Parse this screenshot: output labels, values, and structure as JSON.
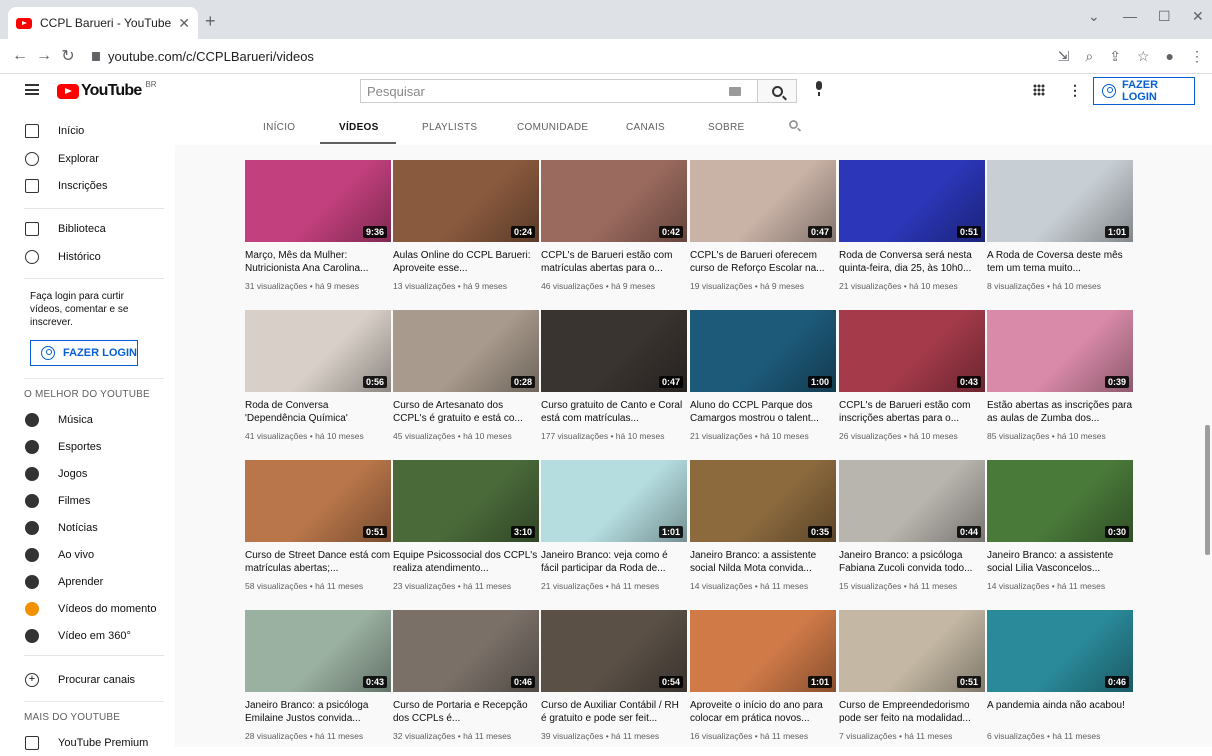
{
  "browser": {
    "tab_title": "CCPL Barueri - YouTube",
    "url": "youtube.com/c/CCPLBarueri/videos"
  },
  "header": {
    "logo_text": "YouTube",
    "country_code": "BR",
    "search_placeholder": "Pesquisar",
    "login_label": "FAZER LOGIN"
  },
  "sidebar": {
    "items": [
      {
        "label": "Início",
        "icon": "home-icon"
      },
      {
        "label": "Explorar",
        "icon": "compass-icon"
      },
      {
        "label": "Inscrições",
        "icon": "subscriptions-icon"
      },
      {
        "label": "Biblioteca",
        "icon": "library-icon"
      },
      {
        "label": "Histórico",
        "icon": "history-icon"
      }
    ],
    "login_message": "Faça login para curtir vídeos, comentar e se inscrever.",
    "login_label": "FAZER LOGIN",
    "best_heading": "O MELHOR DO YOUTUBE",
    "best_items": [
      {
        "label": "Música",
        "icon": "music-icon"
      },
      {
        "label": "Esportes",
        "icon": "trophy-icon"
      },
      {
        "label": "Jogos",
        "icon": "gamepad-icon"
      },
      {
        "label": "Filmes",
        "icon": "film-icon"
      },
      {
        "label": "Notícias",
        "icon": "news-icon"
      },
      {
        "label": "Ao vivo",
        "icon": "live-icon"
      },
      {
        "label": "Aprender",
        "icon": "bulb-icon"
      },
      {
        "label": "Vídeos do momento",
        "icon": "trending-icon"
      },
      {
        "label": "Vídeo em 360°",
        "icon": "360-icon"
      }
    ],
    "browse_channels": "Procurar canais",
    "more_heading": "MAIS DO YOUTUBE",
    "more_items": [
      {
        "label": "YouTube Premium",
        "icon": "youtube-premium-icon"
      }
    ]
  },
  "channel_tabs": [
    "INÍCIO",
    "VÍDEOS",
    "PLAYLISTS",
    "COMUNIDADE",
    "CANAIS",
    "SOBRE"
  ],
  "videos": [
    {
      "title": "Março, Mês da Mulher: Nutricionista Ana Carolina...",
      "meta": "31 visualizações • há 9 meses",
      "duration": "9:36",
      "color": "#c2407d"
    },
    {
      "title": "Aulas Online do CCPL Barueri: Aproveite esse...",
      "meta": "13 visualizações • há 9 meses",
      "duration": "0:24",
      "color": "#8a5a3e"
    },
    {
      "title": "CCPL's de Barueri estão com matrículas abertas para o...",
      "meta": "46 visualizações • há 9 meses",
      "duration": "0:42",
      "color": "#9b6a5e"
    },
    {
      "title": "CCPL's de Barueri oferecem curso de Reforço Escolar na...",
      "meta": "19 visualizações • há 9 meses",
      "duration": "0:47",
      "color": "#c9b2a6"
    },
    {
      "title": "Roda de Conversa será nesta quinta-feira, dia 25, às 10h0...",
      "meta": "21 visualizações • há 10 meses",
      "duration": "0:51",
      "color": "#2b36b8"
    },
    {
      "title": "A Roda de Coversa deste mês tem um tema muito...",
      "meta": "8 visualizações • há 10 meses",
      "duration": "1:01",
      "color": "#c8cfd4"
    },
    {
      "title": "Roda de Conversa 'Dependência Química'",
      "meta": "41 visualizações • há 10 meses",
      "duration": "0:56",
      "color": "#d8d0c8"
    },
    {
      "title": "Curso de Artesanato dos CCPL's é gratuito e está co...",
      "meta": "45 visualizações • há 10 meses",
      "duration": "0:28",
      "color": "#a89a8c"
    },
    {
      "title": "Curso gratuito de Canto e Coral está com matrículas...",
      "meta": "177 visualizações • há 10 meses",
      "duration": "0:47",
      "color": "#3a3430"
    },
    {
      "title": "Aluno do CCPL Parque dos Camargos mostrou o talent...",
      "meta": "21 visualizações • há 10 meses",
      "duration": "1:00",
      "color": "#1d5a7a"
    },
    {
      "title": "CCPL's de Barueri estão com inscrições abertas para o...",
      "meta": "26 visualizações • há 10 meses",
      "duration": "0:43",
      "color": "#a43a4a"
    },
    {
      "title": "Estão abertas as inscrições para as aulas de Zumba dos...",
      "meta": "85 visualizações • há 10 meses",
      "duration": "0:39",
      "color": "#d98aa8"
    },
    {
      "title": "Curso de Street Dance está com matrículas abertas;...",
      "meta": "58 visualizações • há 11 meses",
      "duration": "0:51",
      "color": "#b8764a"
    },
    {
      "title": "Equipe Psicossocial dos CCPL's realiza atendimento...",
      "meta": "23 visualizações • há 11 meses",
      "duration": "3:10",
      "color": "#4a6a3a"
    },
    {
      "title": "Janeiro Branco: veja como é fácil participar da Roda de...",
      "meta": "21 visualizações • há 11 meses",
      "duration": "1:01",
      "color": "#b5dde0"
    },
    {
      "title": "Janeiro Branco: a assistente social Nilda Mota convida...",
      "meta": "14 visualizações • há 11 meses",
      "duration": "0:35",
      "color": "#8c6a3e"
    },
    {
      "title": "Janeiro Branco: a psicóloga Fabiana Zucoli convida todo...",
      "meta": "15 visualizações • há 11 meses",
      "duration": "0:44",
      "color": "#b8b4ae"
    },
    {
      "title": "Janeiro Branco: a assistente social Lilia Vasconcelos...",
      "meta": "14 visualizações • há 11 meses",
      "duration": "0:30",
      "color": "#4a7a3a"
    },
    {
      "title": "Janeiro Branco: a psicóloga Emilaine Justos convida...",
      "meta": "28 visualizações • há 11 meses",
      "duration": "0:43",
      "color": "#9ab0a0"
    },
    {
      "title": "Curso de Portaria e Recepção dos CCPLs é...",
      "meta": "32 visualizações • há 11 meses",
      "duration": "0:46",
      "color": "#7a7068"
    },
    {
      "title": "Curso de Auxiliar Contábil / RH é gratuito e pode ser feit...",
      "meta": "39 visualizações • há 11 meses",
      "duration": "0:54",
      "color": "#5a5046"
    },
    {
      "title": "Aproveite o início do ano para colocar em prática novos...",
      "meta": "16 visualizações • há 11 meses",
      "duration": "1:01",
      "color": "#d07a48"
    },
    {
      "title": "Curso de Empreendedorismo pode ser feito na modalidad...",
      "meta": "7 visualizações • há 11 meses",
      "duration": "0:51",
      "color": "#c4b8a4"
    },
    {
      "title": "A pandemia ainda não acabou!",
      "meta": "6 visualizações • há 11 meses",
      "duration": "0:46",
      "color": "#2a8a9a"
    }
  ]
}
